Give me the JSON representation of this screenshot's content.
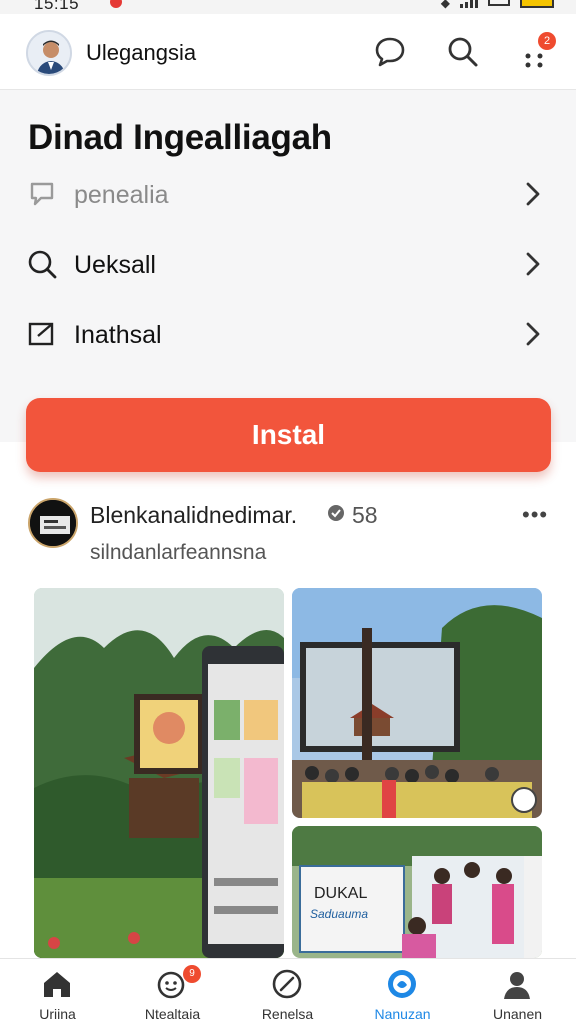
{
  "status_bar": {
    "time": "15:15"
  },
  "header": {
    "title": "Ulegangsia",
    "icons": [
      "chat-icon",
      "search-icon",
      "apps-icon"
    ],
    "badge": "2"
  },
  "menu": {
    "title": "Dinad Ingealliagah",
    "items": [
      {
        "label": "peneali​a",
        "icon": "chat-bubble-icon",
        "muted": true
      },
      {
        "label": "Ueksall",
        "icon": "search-icon"
      },
      {
        "label": "Inathsal",
        "icon": "edit-icon"
      }
    ],
    "install_label": "Instal"
  },
  "post": {
    "name": "Blenkanalidnedimar.",
    "count": "58",
    "subtitle": "silndanlarfeannsna",
    "more": "•••",
    "photo_sign_text": [
      "DUKAL",
      "Saduauma"
    ]
  },
  "bottom_nav": [
    {
      "label": "Uriina",
      "icon": "home-icon"
    },
    {
      "label": "Ntealtaia",
      "icon": "smile-icon",
      "badge": "9"
    },
    {
      "label": "Renelsa",
      "icon": "compass-icon"
    },
    {
      "label": "Nanuzan",
      "icon": "globe-icon",
      "active": true
    },
    {
      "label": "Unanen",
      "icon": "profile-icon"
    }
  ],
  "colors": {
    "accent": "#f2553c",
    "active_nav": "#1e88e5",
    "badge": "#ef4b2f"
  }
}
